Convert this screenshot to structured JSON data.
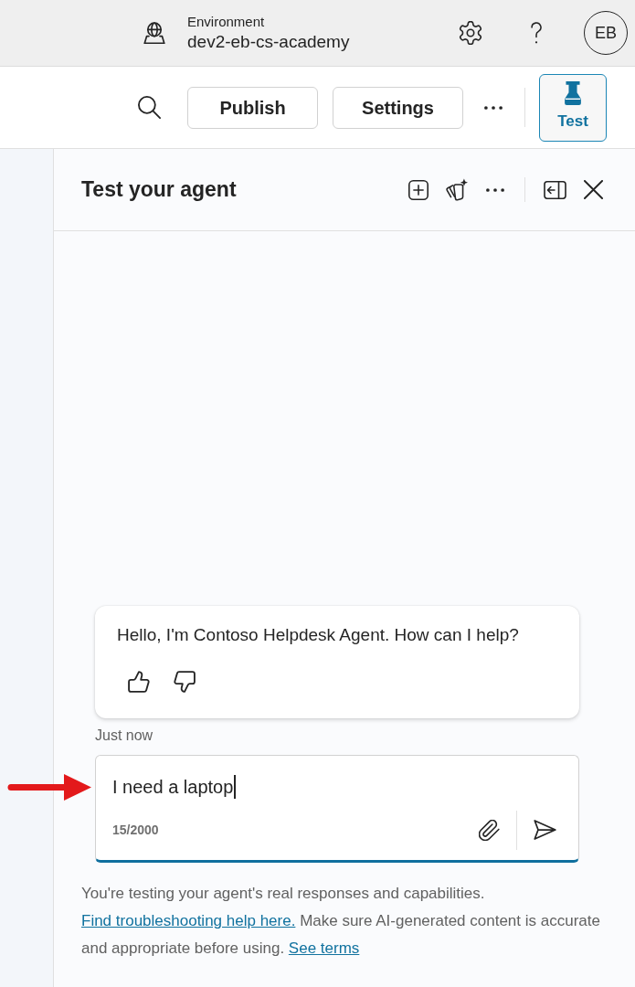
{
  "top_bar": {
    "environment_label": "Environment",
    "environment_name": "dev2-eb-cs-academy",
    "avatar_initials": "EB"
  },
  "command_bar": {
    "buttons": [
      {
        "label": "Publish"
      },
      {
        "label": "Settings"
      }
    ],
    "test_button": {
      "label": "Test",
      "selected": true
    }
  },
  "test_panel": {
    "title": "Test your agent",
    "messages": [
      {
        "kind": "bot",
        "text": "Hello, I'm Contoso Helpdesk Agent. How can I help?",
        "time": "Just now"
      }
    ],
    "composer": {
      "value": "I need a laptop",
      "counter": "15/2000",
      "focused": true
    },
    "disclaimer": [
      {
        "kind": "text",
        "text": "You're testing your agent's real responses and capabilities."
      },
      {
        "kind": "link",
        "text": "Find troubleshooting help here."
      },
      {
        "kind": "text",
        "text": "Make sure AI-generated content is accurate and appropriate before using."
      },
      {
        "kind": "link",
        "text": "See terms"
      }
    ]
  }
}
